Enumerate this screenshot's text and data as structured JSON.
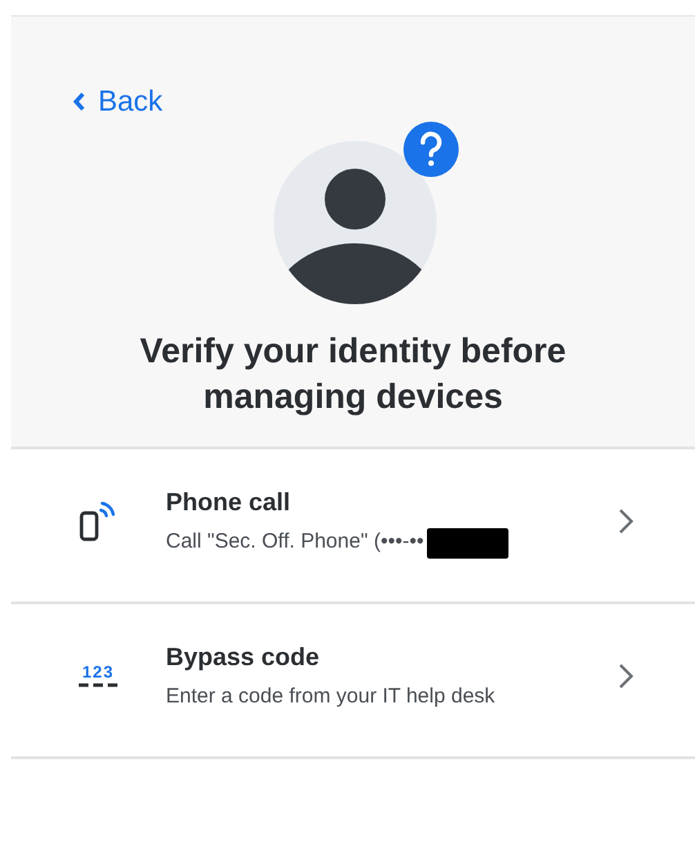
{
  "back_link": {
    "label": "Back"
  },
  "heading": "Verify your identity before managing devices",
  "options": [
    {
      "kind": "phone",
      "title": "Phone call",
      "subtitle": "Call \"Sec. Off. Phone\" (•••-••",
      "redacted": true
    },
    {
      "kind": "code",
      "icon_text": "123",
      "title": "Bypass code",
      "subtitle": "Enter a code from your IT help desk",
      "redacted": false
    }
  ]
}
